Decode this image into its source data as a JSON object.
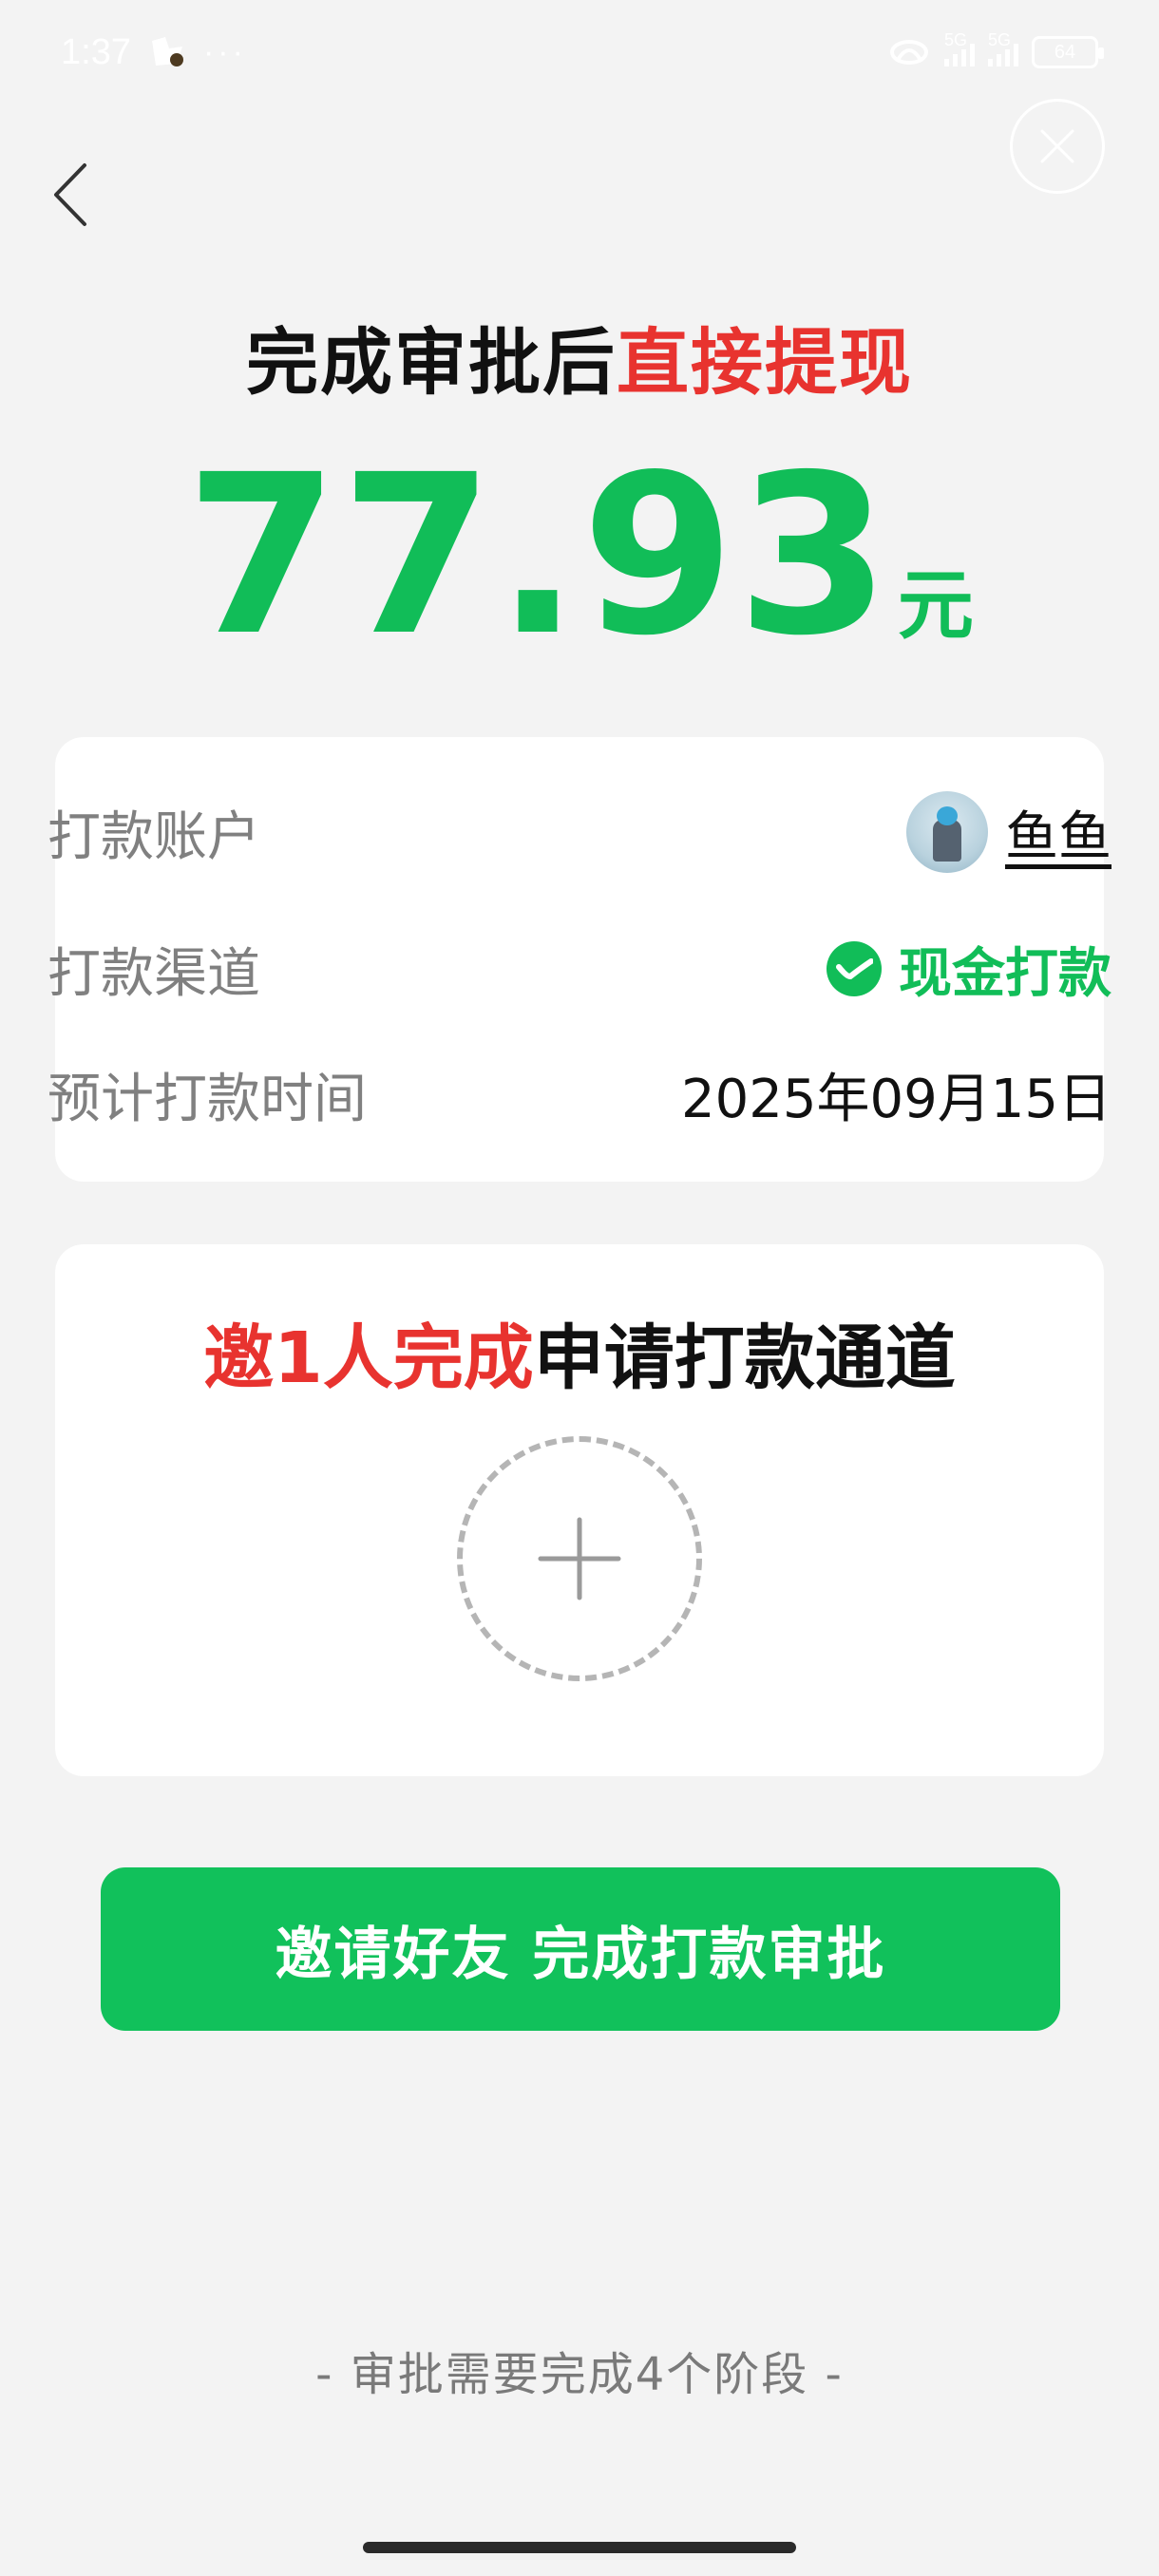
{
  "status_bar": {
    "time": "1:37",
    "more": "···",
    "network_1": "5G",
    "network_2": "5G",
    "battery": "64"
  },
  "nav": {
    "back_icon": "chevron-left-icon",
    "close_icon": "close-circle-icon"
  },
  "headline": {
    "prefix": "完成审批后",
    "highlight": "直接提现"
  },
  "amount": {
    "value": "77.93",
    "unit": "元"
  },
  "info": {
    "account_label": "打款账户",
    "account_name": "鱼鱼",
    "channel_label": "打款渠道",
    "channel_value": "现金打款",
    "time_label": "预计打款时间",
    "time_value": "2025年09月15日"
  },
  "invite": {
    "title_highlight": "邀1人完成",
    "title_rest": "申请打款通道",
    "add_icon": "plus-icon"
  },
  "cta": {
    "label": "邀请好友 完成打款审批"
  },
  "footer": {
    "note": "- 审批需要完成4个阶段 -"
  },
  "colors": {
    "accent_green": "#11bd58",
    "accent_red": "#e8332f",
    "background": "#f3f3f3"
  }
}
